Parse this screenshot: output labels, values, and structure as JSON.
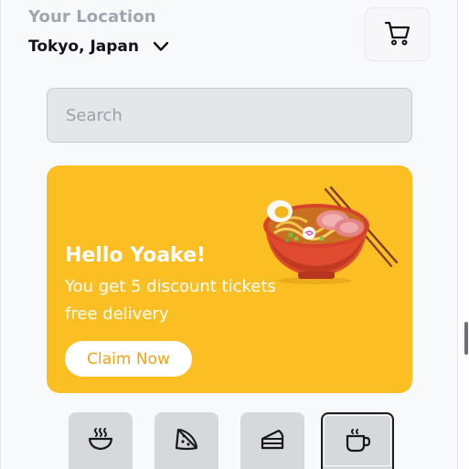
{
  "header": {
    "location_label": "Your Location",
    "location_value": "Tokyo, Japan"
  },
  "icons": {
    "location_dropdown": "chevron-down-icon",
    "cart": "shopping-cart-icon"
  },
  "search": {
    "placeholder": "Search",
    "value": ""
  },
  "promo": {
    "greeting": "Hello Yoake!",
    "line1": "You get 5 discount tickets",
    "line2": "free delivery",
    "cta_label": "Claim Now",
    "image": "ramen-bowl-illustration",
    "background_color": "#FBBF24",
    "cta_text_color": "#F2A40C"
  },
  "categories": [
    {
      "icon": "soup-bowl-icon",
      "selected": false
    },
    {
      "icon": "pizza-slice-icon",
      "selected": false
    },
    {
      "icon": "cake-slice-icon",
      "selected": false
    },
    {
      "icon": "coffee-cup-icon",
      "selected": true
    }
  ]
}
